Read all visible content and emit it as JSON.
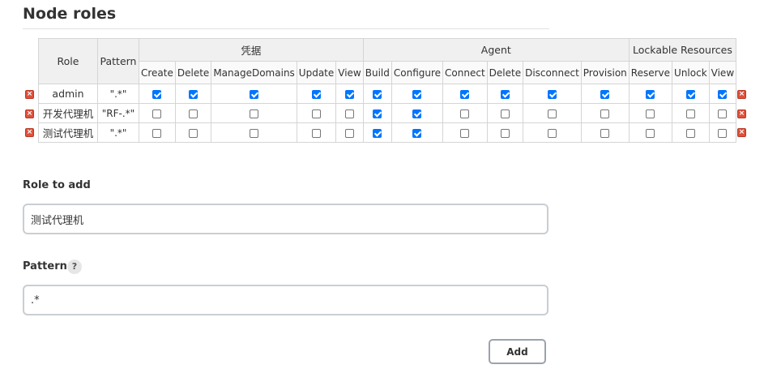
{
  "section_title": "Node roles",
  "table": {
    "role_header": "Role",
    "pattern_header": "Pattern",
    "groups": [
      {
        "name": "凭据",
        "permissions": [
          "Create",
          "Delete",
          "ManageDomains",
          "Update",
          "View"
        ]
      },
      {
        "name": "Agent",
        "permissions": [
          "Build",
          "Configure",
          "Connect",
          "Delete",
          "Disconnect",
          "Provision"
        ]
      },
      {
        "name": "Lockable Resources",
        "permissions": [
          "Reserve",
          "Unlock",
          "View"
        ]
      }
    ],
    "rows": [
      {
        "role": "admin",
        "pattern": "\".*\"",
        "checks": [
          true,
          true,
          true,
          true,
          true,
          true,
          true,
          true,
          true,
          true,
          true,
          true,
          true,
          true
        ]
      },
      {
        "role": "开发代理机",
        "pattern": "\"RF-.*\"",
        "checks": [
          false,
          false,
          false,
          false,
          false,
          true,
          true,
          false,
          false,
          false,
          false,
          false,
          false,
          false
        ]
      },
      {
        "role": "测试代理机",
        "pattern": "\".*\"",
        "checks": [
          false,
          false,
          false,
          false,
          false,
          true,
          true,
          false,
          false,
          false,
          false,
          false,
          false,
          false
        ]
      }
    ],
    "delete_icon": "×"
  },
  "role_to_add": {
    "label": "Role to add",
    "value": "测试代理机"
  },
  "pattern_field": {
    "label": "Pattern",
    "help_icon": "?",
    "value": ".*"
  },
  "add_button": {
    "label": "Add"
  },
  "colors": {
    "checkbox_checked": "#0075ff",
    "delete_icon": "#e0503a",
    "header_bg": "#f0f0f0"
  }
}
